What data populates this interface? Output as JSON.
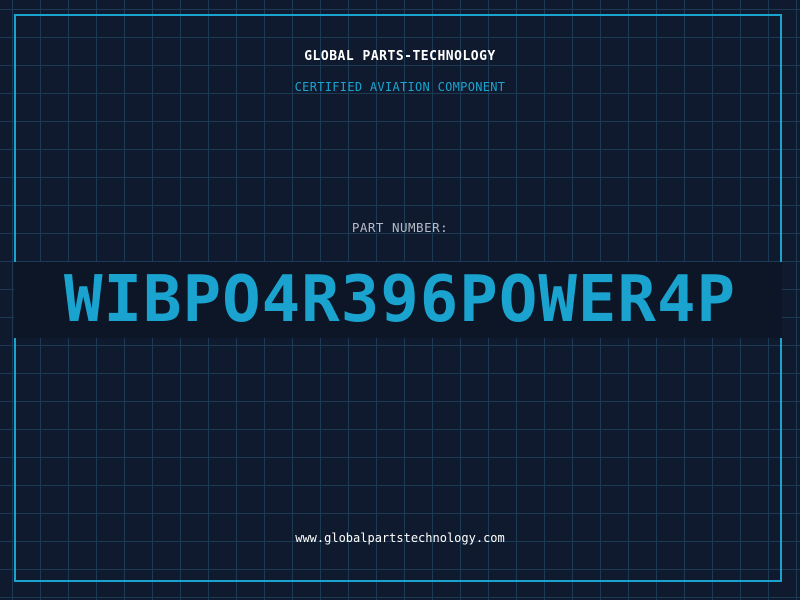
{
  "header": {
    "brand": "GLOBAL PARTS-TECHNOLOGY",
    "subtitle": "CERTIFIED AVIATION COMPONENT"
  },
  "part": {
    "label": "PART NUMBER:",
    "number": "WIBPO4R396POWER4P"
  },
  "footer": {
    "url": "www.globalpartstechnology.com"
  },
  "colors": {
    "background": "#101a2e",
    "grid": "#1d3a55",
    "accent": "#1aa3cf",
    "text": "#ffffff",
    "muted": "#b3bcc8"
  }
}
